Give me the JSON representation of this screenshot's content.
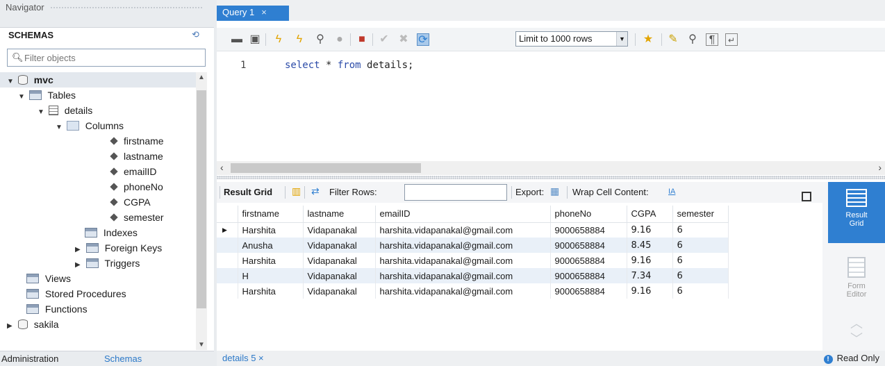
{
  "navigator": {
    "title": "Navigator",
    "schemas_label": "SCHEMAS",
    "filter_placeholder": "Filter objects",
    "tree": {
      "schema": "mvc",
      "tables": "Tables",
      "table": "details",
      "columns_label": "Columns",
      "columns": [
        "firstname",
        "lastname",
        "emailID",
        "phoneNo",
        "CGPA",
        "semester"
      ],
      "indexes": "Indexes",
      "foreign_keys": "Foreign Keys",
      "triggers": "Triggers",
      "views": "Views",
      "stored_procedures": "Stored Procedures",
      "functions": "Functions",
      "other_schema": "sakila"
    },
    "tabs": {
      "administration": "Administration",
      "schemas": "Schemas"
    }
  },
  "query_tab": {
    "label": "Query 1",
    "close": "×"
  },
  "toolbar": {
    "limit": "Limit to 1000 rows"
  },
  "editor": {
    "line": "1",
    "kw1": "select",
    "mid": " * ",
    "kw2": "from",
    "rest": " details;"
  },
  "result_toolbar": {
    "result_grid": "Result Grid",
    "filter_rows": "Filter Rows:",
    "export": "Export:",
    "wrap": "Wrap Cell Content:"
  },
  "grid": {
    "columns": [
      "firstname",
      "lastname",
      "emailID",
      "phoneNo",
      "CGPA",
      "semester"
    ],
    "rows": [
      [
        "Harshita",
        "Vidapanakal",
        "harshita.vidapanakal@gmail.com",
        "9000658884",
        "9.16",
        "6"
      ],
      [
        "Anusha",
        "Vidapanakal",
        "harshita.vidapanakal@gmail.com",
        "9000658884",
        "8.45",
        "6"
      ],
      [
        "Harshita",
        "Vidapanakal",
        "harshita.vidapanakal@gmail.com",
        "9000658884",
        "9.16",
        "6"
      ],
      [
        "H",
        "Vidapanakal",
        "harshita.vidapanakal@gmail.com",
        "9000658884",
        "7.34",
        "6"
      ],
      [
        "Harshita",
        "Vidapanakal",
        "harshita.vidapanakal@gmail.com",
        "9000658884",
        "9.16",
        "6"
      ]
    ]
  },
  "side_panel": {
    "result_grid_1": "Result",
    "result_grid_2": "Grid",
    "form_editor_1": "Form",
    "form_editor_2": "Editor"
  },
  "bottom": {
    "details_tab": "details 5",
    "close": "×",
    "read_only": "Read Only"
  },
  "colors": {
    "accent": "#2f7fd1",
    "alt_row": "#e9f0f8",
    "keyword": "#2b4ba8"
  }
}
